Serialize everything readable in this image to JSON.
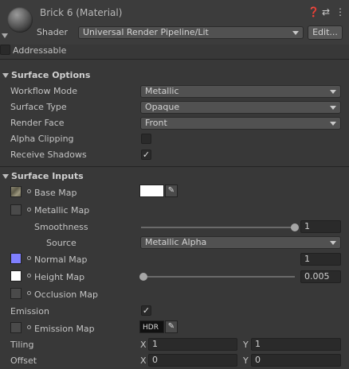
{
  "header": {
    "title": "Brick 6 (Material)",
    "help_icon": "help-icon",
    "settings_icon": "preset-icon",
    "menu_icon": "kebab-menu-icon",
    "shader_label": "Shader",
    "shader_value": "Universal Render Pipeline/Lit",
    "edit_button": "Edit...",
    "addressable_label": "Addressable",
    "addressable_checked": false
  },
  "surface_options": {
    "title": "Surface Options",
    "workflow_mode": {
      "label": "Workflow Mode",
      "value": "Metallic"
    },
    "surface_type": {
      "label": "Surface Type",
      "value": "Opaque"
    },
    "render_face": {
      "label": "Render Face",
      "value": "Front"
    },
    "alpha_clipping": {
      "label": "Alpha Clipping",
      "checked": false
    },
    "receive_shadows": {
      "label": "Receive Shadows",
      "checked": true,
      "mark": "✓"
    }
  },
  "surface_inputs": {
    "title": "Surface Inputs",
    "base_map": {
      "label": "Base Map",
      "color": "#ffffff"
    },
    "metallic_map": {
      "label": "Metallic Map"
    },
    "smoothness": {
      "label": "Smoothness",
      "value": "1",
      "fraction": 1.0
    },
    "source": {
      "label": "Source",
      "value": "Metallic Alpha"
    },
    "normal_map": {
      "label": "Normal Map",
      "value": "1",
      "swatch": "#8080ff"
    },
    "height_map": {
      "label": "Height Map",
      "value": "0.005",
      "fraction": 0.0,
      "swatch": "#ffffff"
    },
    "occlusion_map": {
      "label": "Occlusion Map"
    },
    "emission": {
      "label": "Emission",
      "checked": true,
      "mark": "✓"
    },
    "emission_map": {
      "label": "Emission Map",
      "hdr": "HDR"
    },
    "tiling": {
      "label": "Tiling",
      "x_label": "X",
      "x": "1",
      "y_label": "Y",
      "y": "1"
    },
    "offset": {
      "label": "Offset",
      "x_label": "X",
      "x": "0",
      "y_label": "Y",
      "y": "0"
    }
  }
}
